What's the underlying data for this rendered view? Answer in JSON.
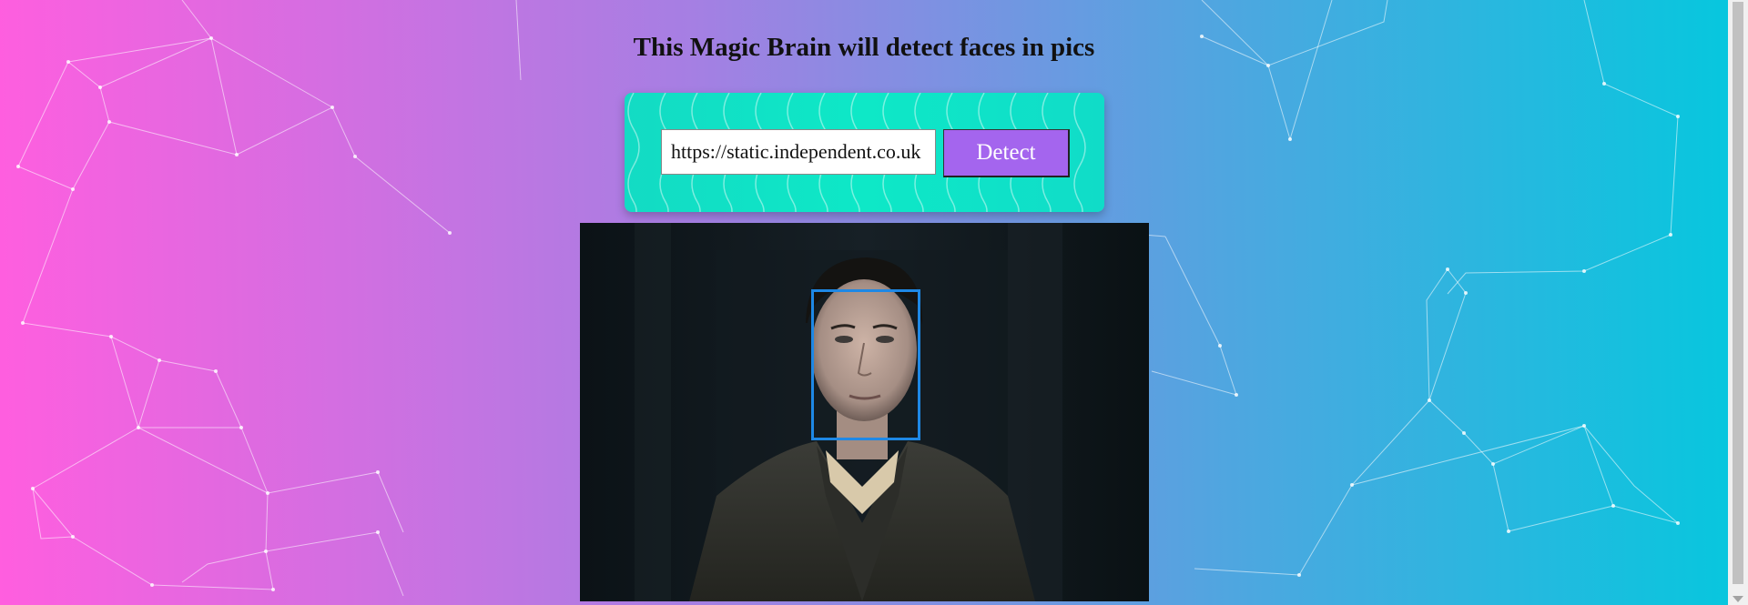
{
  "page": {
    "title": "This Magic Brain will detect faces in pics"
  },
  "form": {
    "url_value": "https://static.independent.co.uk",
    "detect_label": "Detect"
  },
  "colors": {
    "gradient_left": "#ff5edf",
    "gradient_right": "#04c8de",
    "card_teal": "#0ee8c7",
    "button_purple": "#a465ee",
    "face_box_blue": "#1e88e5"
  },
  "icons": {
    "scroll_down": "chevron-down-icon"
  }
}
